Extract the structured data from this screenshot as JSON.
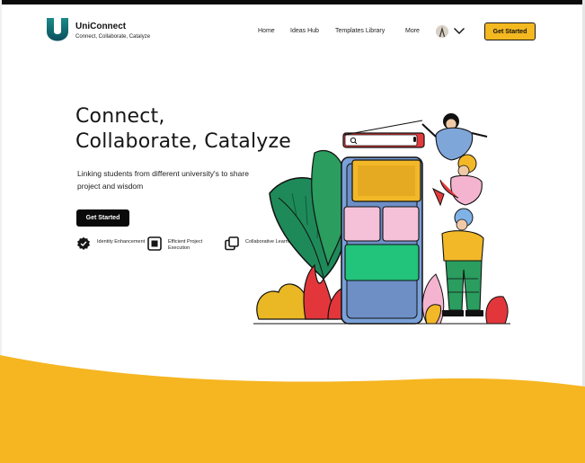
{
  "brand": {
    "name": "UniConnect",
    "tagline": "Connect, Collaborate, Catalyze",
    "accent": "#f4b820",
    "logo_color": "#0f6f74"
  },
  "nav": {
    "items": [
      {
        "label": "Home"
      },
      {
        "label": "Ideas Hub"
      },
      {
        "label": "Templates Library"
      },
      {
        "label": "More"
      }
    ],
    "cta_label": "Get Started"
  },
  "hero": {
    "title_line1": "Connect,",
    "title_line2": "Collaborate, Catalyze",
    "subtitle": "Linking students from different university's to share project and wisdom",
    "cta_label": "Get Started"
  },
  "features": [
    {
      "icon": "badge-check-icon",
      "label": "Identity Enhancement"
    },
    {
      "icon": "frame-icon",
      "label": "Efficient Project Execution"
    },
    {
      "icon": "copy-squares-icon",
      "label": "Collaborative Learning"
    }
  ],
  "colors": {
    "wave": "#f5b622",
    "dark": "#0a0a0a"
  }
}
